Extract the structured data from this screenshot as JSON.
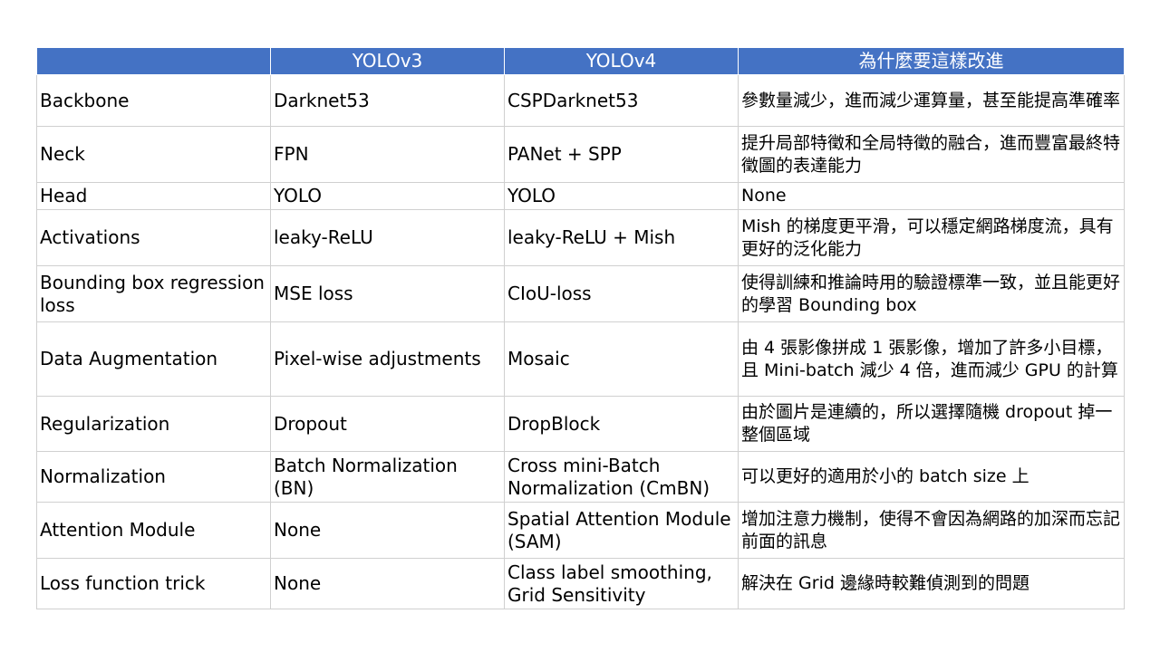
{
  "table": {
    "headers": [
      "",
      "YOLOv3",
      "YOLOv4",
      "為什麼要這樣改進"
    ],
    "rows": [
      [
        "Backbone",
        "Darknet53",
        "CSPDarknet53",
        "參數量減少，進而減少運算量，甚至能提高準確率"
      ],
      [
        "Neck",
        "FPN",
        "PANet + SPP",
        "提升局部特徵和全局特徵的融合，進而豐富最終特徵圖的表達能力"
      ],
      [
        "Head",
        "YOLO",
        "YOLO",
        "None"
      ],
      [
        "Activations",
        "leaky-ReLU",
        "leaky-ReLU + Mish",
        "Mish 的梯度更平滑，可以穩定網路梯度流，具有更好的泛化能力"
      ],
      [
        "Bounding box regression loss",
        "MSE loss",
        "CIoU-loss",
        "使得訓練和推論時用的驗證標準一致，並且能更好的學習 Bounding box"
      ],
      [
        "Data Augmentation",
        "Pixel-wise adjustments",
        "Mosaic",
        "由 4 張影像拼成 1 張影像，增加了許多小目標，且 Mini-batch 減少 4 倍，進而減少 GPU 的計算"
      ],
      [
        "Regularization",
        "Dropout",
        "DropBlock",
        "由於圖片是連續的，所以選擇隨機 dropout 掉一整個區域"
      ],
      [
        "Normalization",
        "Batch Normalization (BN)",
        "Cross mini-Batch Normalization (CmBN)",
        "可以更好的適用於小的 batch size 上"
      ],
      [
        "Attention Module",
        "None",
        "Spatial Attention Module (SAM)",
        "增加注意力機制，使得不會因為網路的加深而忘記前面的訊息"
      ],
      [
        "Loss function trick",
        "None",
        "Class label smoothing, Grid Sensitivity",
        "解決在 Grid 邊緣時較難偵測到的問題"
      ]
    ]
  },
  "colors": {
    "header_bg": "#4472c4",
    "header_text": "#ffffff",
    "border": "#d0d0d0"
  }
}
